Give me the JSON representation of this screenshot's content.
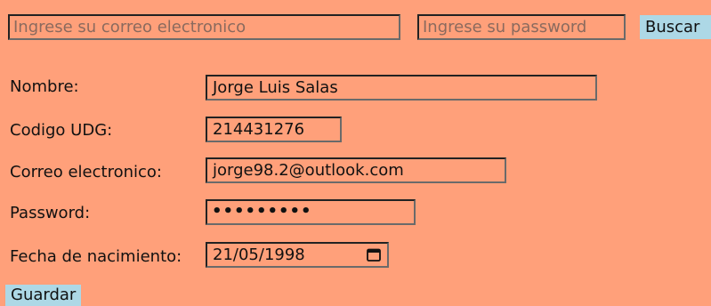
{
  "search": {
    "email_placeholder": "Ingrese su correo electronico",
    "password_placeholder": "Ingrese su password",
    "button_label": "Buscar"
  },
  "form": {
    "nombre": {
      "label": "Nombre:",
      "value": "Jorge Luis Salas"
    },
    "codigo": {
      "label": "Codigo UDG:",
      "value": "214431276"
    },
    "correo": {
      "label": "Correo electronico:",
      "value": "jorge98.2@outlook.com"
    },
    "password": {
      "label": "Password:",
      "masked": "•••••••••"
    },
    "fecha": {
      "label": "Fecha de nacimiento:",
      "value": "21/05/1998",
      "icon": "calendar-icon"
    },
    "save_label": "Guardar"
  },
  "colors": {
    "background": "#FFA07A",
    "button": "#ADD8E6"
  }
}
